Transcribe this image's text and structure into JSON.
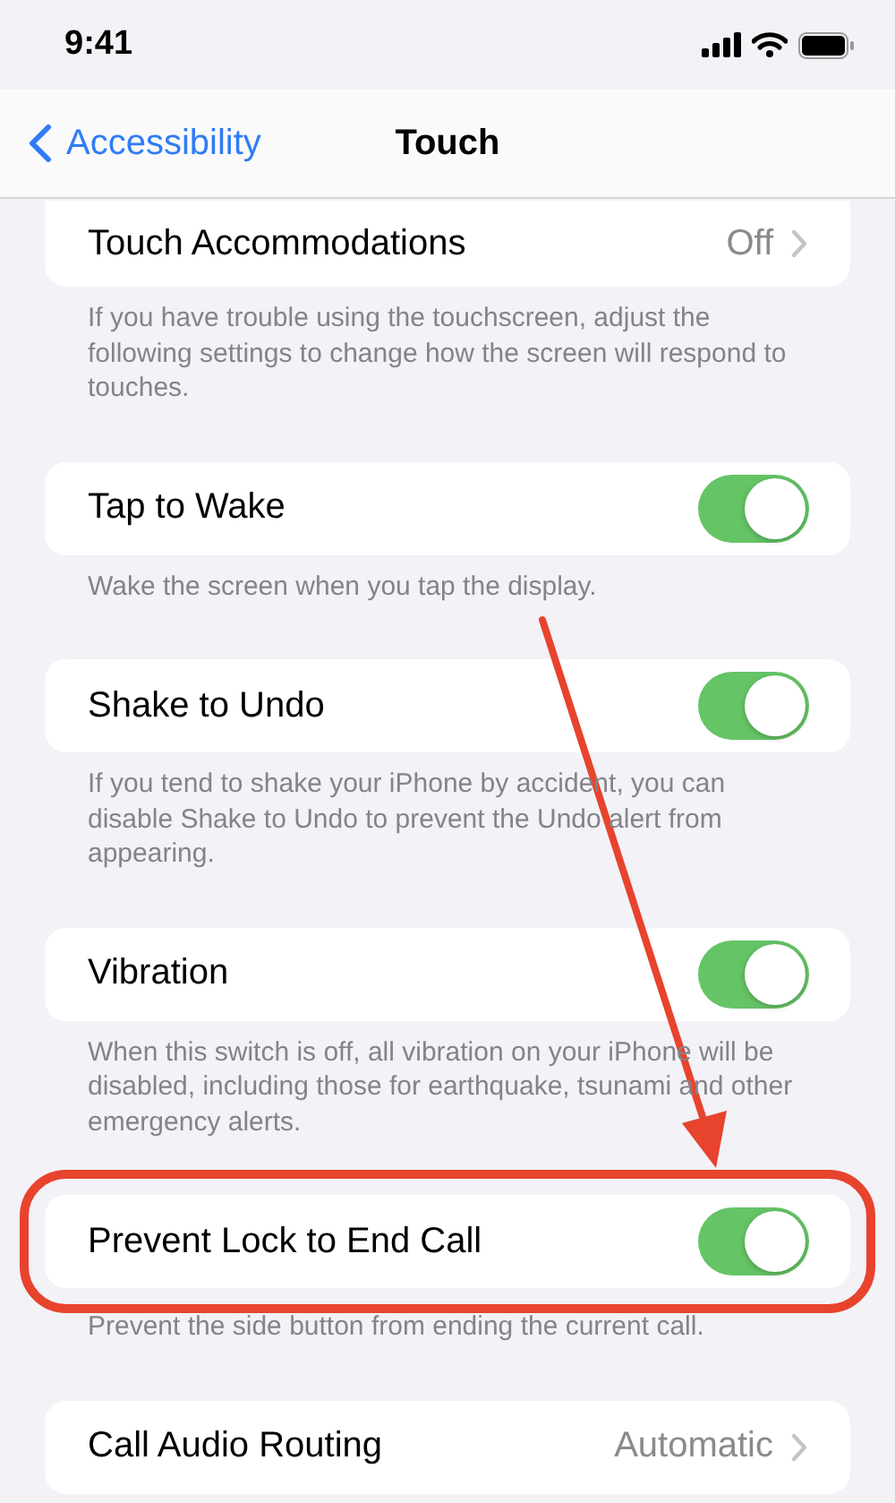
{
  "status_bar": {
    "time": "9:41"
  },
  "nav": {
    "back": "Accessibility",
    "title": "Touch"
  },
  "sections": [
    {
      "label": "Touch Accommodations",
      "kind": "value",
      "value": "Off",
      "highlighted": false,
      "footer": "If you have trouble using the touchscreen, adjust the following settings to change how the screen will respond to touches."
    },
    {
      "label": "Tap to Wake",
      "kind": "toggle",
      "on": true,
      "highlighted": false,
      "footer": "Wake the screen when you tap the display."
    },
    {
      "label": "Shake to Undo",
      "kind": "toggle",
      "on": true,
      "highlighted": false,
      "footer": "If you tend to shake your iPhone by accident, you can disable Shake to Undo to prevent the Undo alert from appearing."
    },
    {
      "label": "Vibration",
      "kind": "toggle",
      "on": true,
      "highlighted": false,
      "footer": "When this switch is off, all vibration on your iPhone will be disabled, including those for earthquake, tsunami and other emergency alerts."
    },
    {
      "label": "Prevent Lock to End Call",
      "kind": "toggle",
      "on": true,
      "highlighted": true,
      "footer": "Prevent the side button from ending the current call."
    },
    {
      "label": "Call Audio Routing",
      "kind": "value",
      "value": "Automatic",
      "highlighted": false
    }
  ]
}
